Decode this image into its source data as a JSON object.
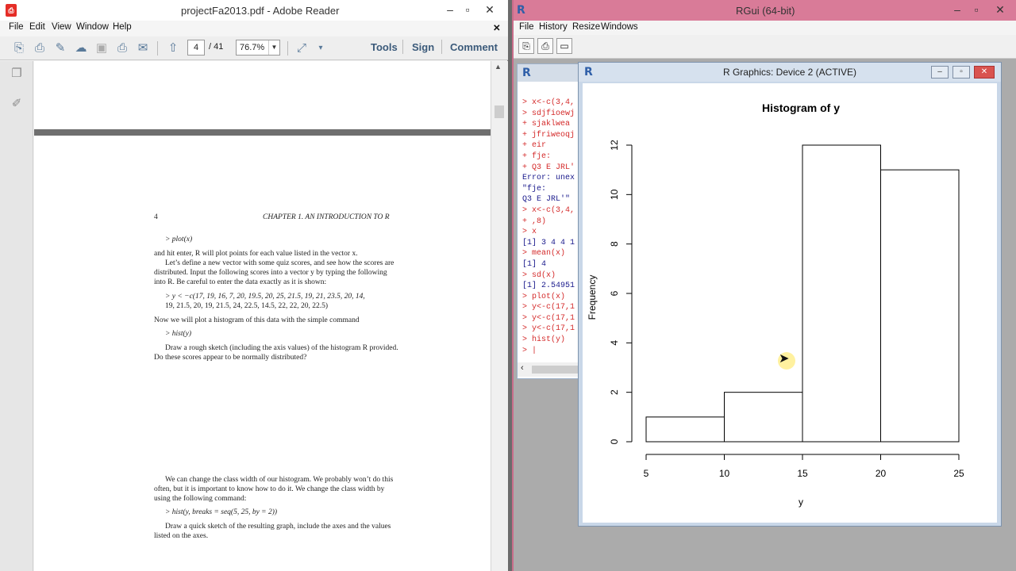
{
  "reader": {
    "title": "projectFa2013.pdf - Adobe Reader",
    "menu": [
      "File",
      "Edit",
      "View",
      "Window",
      "Help"
    ],
    "page_current": "4",
    "page_total": "/ 41",
    "zoom": "76.7%",
    "tools_label": "Tools",
    "sign_label": "Sign",
    "comment_label": "Comment",
    "doc": {
      "page_number": "4",
      "header": "CHAPTER 1.   AN INTRODUCTION TO R",
      "lines": [
        "> plot(x)",
        "and hit enter, R will plot points for each value listed in the vector x.",
        "Let’s define a new vector with some quiz scores, and see how the scores are",
        "distributed.  Input the following scores into a vector y by typing the following",
        "into R. Be careful to enter the data exactly as it is shown:",
        "> y < −c(17, 19, 16, 7, 20, 19.5, 20, 25, 21.5, 19, 21, 23.5, 20, 14,",
        "19, 21.5, 20, 19, 21.5, 24, 22.5, 14.5, 22, 22, 20, 22.5)",
        "Now we will plot a histogram of this data with the simple command",
        "> hist(y)",
        "Draw a rough sketch (including the axis values) of the histogram R provided.",
        "Do these scores appear to be normally distributed?",
        "We can change the class width of our histogram.  We probably won’t do this",
        "often, but it is important to know how to do it.  We change the class width by",
        "using the following command:",
        "> hist(y, breaks = seq(5, 25, by = 2))",
        "Draw a quick sketch of the resulting graph, include the axes and the values",
        "listed on the axes."
      ]
    }
  },
  "rgui": {
    "title": "RGui (64-bit)",
    "menu": [
      "File",
      "History",
      "Resize",
      "Windows"
    ],
    "console_lines": [
      {
        "text": "> x<-c(3,4,",
        "kind": "in"
      },
      {
        "text": "> sdjfioewj",
        "kind": "in"
      },
      {
        "text": "+ sjaklwea",
        "kind": "in"
      },
      {
        "text": "+ jfriweoqj",
        "kind": "in"
      },
      {
        "text": "+ eir",
        "kind": "in"
      },
      {
        "text": "+ fje:",
        "kind": "in"
      },
      {
        "text": "+ Q3 E JRL'",
        "kind": "in"
      },
      {
        "text": "Error: unex",
        "kind": "out"
      },
      {
        "text": "\"fje:",
        "kind": "out"
      },
      {
        "text": "Q3 E JRL'\"",
        "kind": "out"
      },
      {
        "text": "> x<-c(3,4,",
        "kind": "in"
      },
      {
        "text": "+ ,8)",
        "kind": "in"
      },
      {
        "text": "> x",
        "kind": "in"
      },
      {
        "text": "[1] 3 4 4 1",
        "kind": "out"
      },
      {
        "text": "> mean(x)",
        "kind": "in"
      },
      {
        "text": "[1] 4",
        "kind": "out"
      },
      {
        "text": "> sd(x)",
        "kind": "in"
      },
      {
        "text": "[1] 2.54951",
        "kind": "out"
      },
      {
        "text": "> plot(x)",
        "kind": "in"
      },
      {
        "text": "> y<-c(17,1",
        "kind": "in"
      },
      {
        "text": "> y<-c(17,1",
        "kind": "in"
      },
      {
        "text": "> y<-c(17,1",
        "kind": "in"
      },
      {
        "text": "> hist(y)",
        "kind": "in"
      },
      {
        "text": "> |",
        "kind": "in"
      }
    ],
    "graphics_title": "R Graphics: Device 2 (ACTIVE)"
  },
  "chart_data": {
    "type": "bar",
    "title": "Histogram of y",
    "xlabel": "y",
    "ylabel": "Frequency",
    "bins": [
      [
        5,
        10
      ],
      [
        10,
        15
      ],
      [
        15,
        20
      ],
      [
        20,
        25
      ]
    ],
    "values": [
      1,
      2,
      12,
      11
    ],
    "xticks": [
      5,
      10,
      15,
      20,
      25
    ],
    "yticks": [
      0,
      2,
      4,
      6,
      8,
      10,
      12
    ],
    "xlim": [
      5,
      25
    ],
    "ylim": [
      0,
      12
    ],
    "grid": false
  }
}
